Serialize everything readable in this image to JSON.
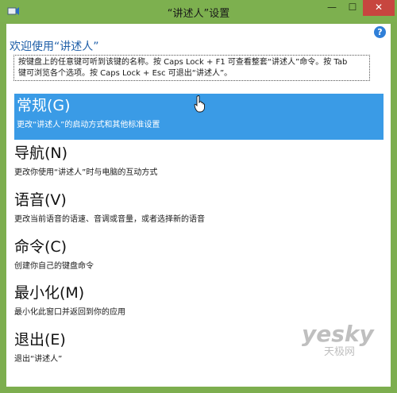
{
  "window": {
    "title": "“讲述人”设置",
    "minimize_glyph": "—",
    "maximize_glyph": "☐",
    "close_glyph": "✕"
  },
  "help": {
    "glyph": "?"
  },
  "welcome": "欢迎使用“讲述人”",
  "info_lines": [
    "按键盘上的任意键可听到该键的名称。按 Caps Lock + F1 可查看整套“讲述人”命令。按 Tab",
    "键可浏览各个选项。按 Caps Lock + Esc 可退出“讲述人”。"
  ],
  "menu": [
    {
      "title": "常规(G)",
      "desc": "更改“讲述人”的启动方式和其他标准设置",
      "selected": true
    },
    {
      "title": "导航(N)",
      "desc": "更改你使用“讲述人”时与电脑的互动方式",
      "selected": false
    },
    {
      "title": "语音(V)",
      "desc": "更改当前语音的语速、音调或音量，或者选择新的语音",
      "selected": false
    },
    {
      "title": "命令(C)",
      "desc": "创建你自己的键盘命令",
      "selected": false
    },
    {
      "title": "最小化(M)",
      "desc": "最小化此窗口并返回到你的应用",
      "selected": false
    },
    {
      "title": "退出(E)",
      "desc": "退出“讲述人”",
      "selected": false
    }
  ],
  "watermark": {
    "brand": "yesky",
    "sub": "天极网"
  },
  "colors": {
    "titlebar": "#7db04f",
    "selected": "#3a9be6",
    "close": "#c7463f",
    "welcome": "#1f5fa8"
  }
}
